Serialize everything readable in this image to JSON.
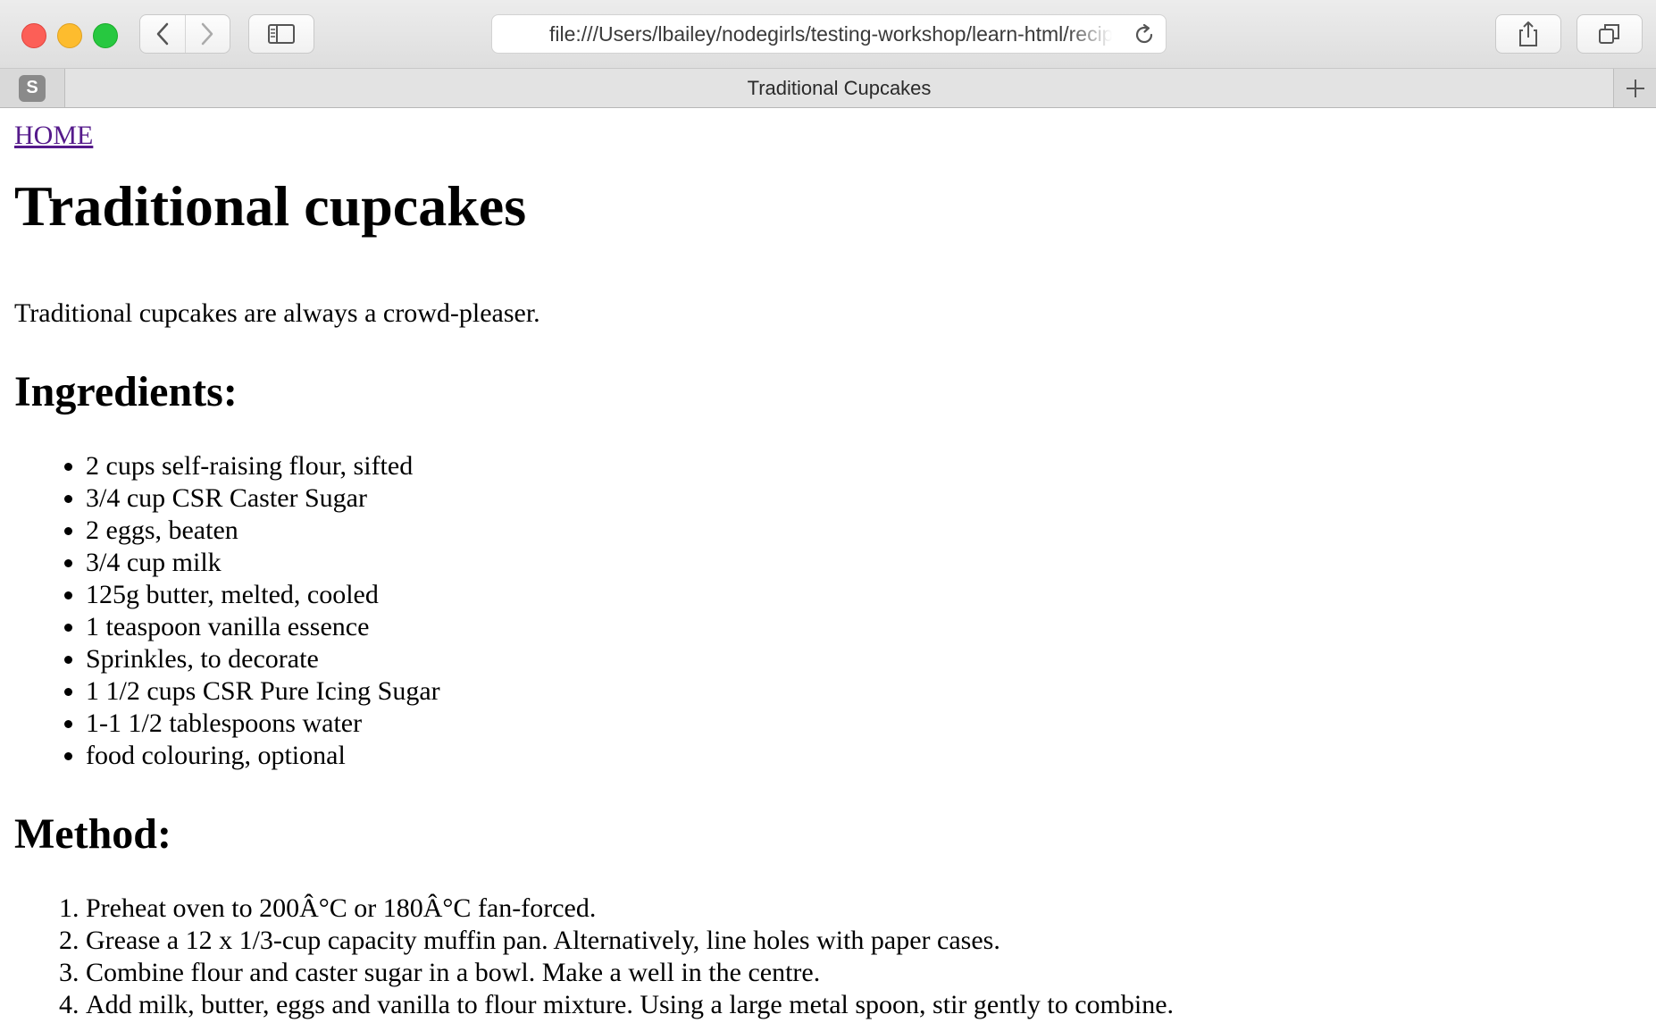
{
  "browser": {
    "url": "file:///Users/lbailey/nodegirls/testing-workshop/learn-html/recipe.html",
    "pinned_tab_letter": "S",
    "tab_title": "Traditional Cupcakes"
  },
  "page": {
    "home_link": "HOME",
    "title": "Traditional cupcakes",
    "intro": "Traditional cupcakes are always a crowd-pleaser.",
    "ingredients_heading": "Ingredients:",
    "ingredients": [
      "2 cups self-raising flour, sifted",
      "3/4 cup CSR Caster Sugar",
      "2 eggs, beaten",
      "3/4 cup milk",
      "125g butter, melted, cooled",
      "1 teaspoon vanilla essence",
      "Sprinkles, to decorate",
      "1 1/2 cups CSR Pure Icing Sugar",
      "1-1 1/2 tablespoons water",
      "food colouring, optional"
    ],
    "method_heading": "Method:",
    "method": [
      "Preheat oven to 200Â°C or 180Â°C fan-forced.",
      "Grease a 12 x 1/3-cup capacity muffin pan. Alternatively, line holes with paper cases.",
      "Combine flour and caster sugar in a bowl. Make a well in the centre.",
      "Add milk, butter, eggs and vanilla to flour mixture. Using a large metal spoon, stir gently to combine."
    ]
  }
}
